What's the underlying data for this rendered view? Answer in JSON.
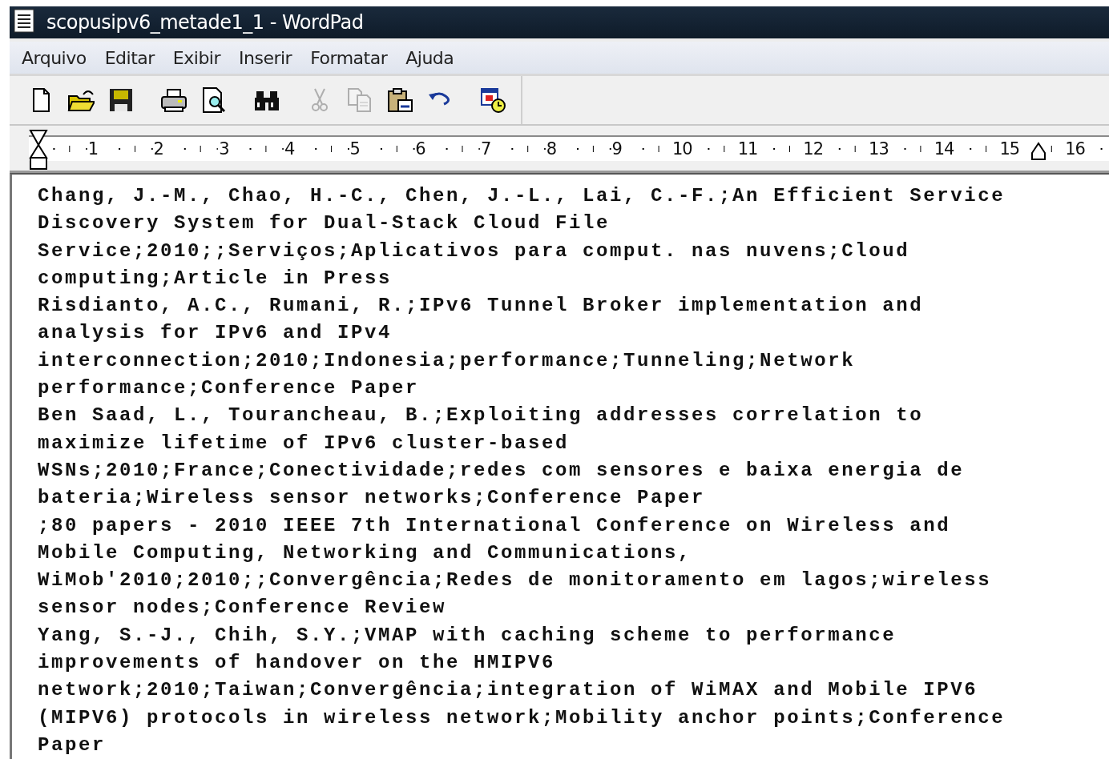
{
  "window": {
    "title": "scopusipv6_metade1_1 - WordPad"
  },
  "menu": [
    "Arquivo",
    "Editar",
    "Exibir",
    "Inserir",
    "Formatar",
    "Ajuda"
  ],
  "toolbar": [
    {
      "kind": "new",
      "disabled": false
    },
    {
      "kind": "open",
      "disabled": false
    },
    {
      "kind": "save",
      "disabled": false
    },
    {
      "kind": "print",
      "disabled": false
    },
    {
      "kind": "preview",
      "disabled": false
    },
    {
      "kind": "find",
      "disabled": false
    },
    {
      "kind": "cut",
      "disabled": true
    },
    {
      "kind": "copy",
      "disabled": true
    },
    {
      "kind": "paste",
      "disabled": false
    },
    {
      "kind": "undo",
      "disabled": false
    },
    {
      "kind": "datetime",
      "disabled": false
    }
  ],
  "ruler": [
    "1",
    "2",
    "3",
    "4",
    "5",
    "6",
    "7",
    "8",
    "9",
    "10",
    "11",
    "12",
    "13",
    "14",
    "15",
    "16"
  ],
  "document": {
    "lines": [
      "Chang, J.-M., Chao, H.-C., Chen, J.-L., Lai, C.-F.;An Efficient Service",
      "Discovery System for Dual-Stack Cloud File",
      "Service;2010;;Serviços;Aplicativos para comput. nas nuvens;Cloud",
      "computing;Article in Press",
      "Risdianto, A.C., Rumani, R.;IPv6 Tunnel Broker implementation and",
      "analysis for IPv6 and IPv4",
      "interconnection;2010;Indonesia;performance;Tunneling;Network",
      "performance;Conference Paper",
      "Ben Saad, L., Tourancheau, B.;Exploiting addresses correlation to",
      "maximize lifetime of IPv6 cluster-based",
      "WSNs;2010;France;Conectividade;redes com sensores e baixa energia de",
      "bateria;Wireless sensor networks;Conference Paper",
      ";80 papers - 2010 IEEE 7th International Conference on Wireless and",
      "Mobile Computing, Networking and Communications,",
      "WiMob'2010;2010;;Convergência;Redes de monitoramento em lagos;wireless",
      "sensor nodes;Conference Review",
      "Yang, S.-J., Chih, S.Y.;VMAP with caching scheme to performance",
      "improvements of handover on the HMIPV6",
      "network;2010;Taiwan;Convergência;integration of WiMAX and Mobile IPV6",
      "(MIPV6) protocols in wireless network;Mobility anchor points;Conference",
      "Paper"
    ]
  }
}
